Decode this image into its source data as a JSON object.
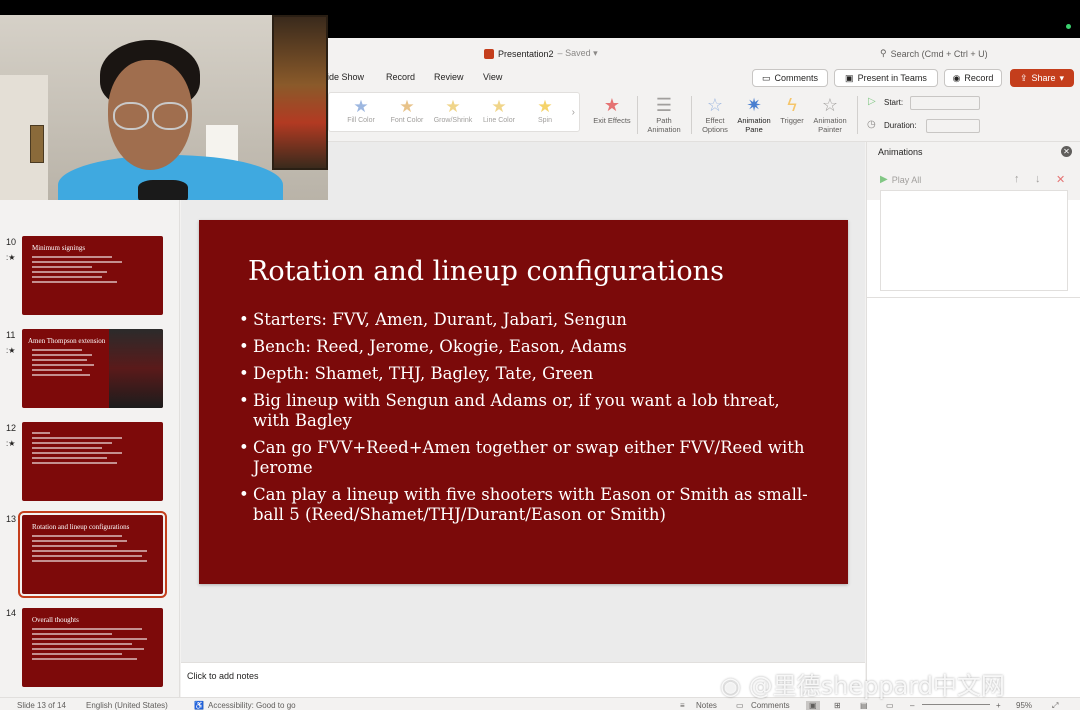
{
  "window": {
    "doc_title": "Presentation2",
    "saved_status": "Saved",
    "search_placeholder": "Search (Cmd + Ctrl + U)"
  },
  "menu": {
    "items": [
      "ide Show",
      "Record",
      "Review",
      "View"
    ],
    "comments_label": "Comments",
    "present_teams_label": "Present in Teams",
    "record_label": "Record",
    "share_label": "Share"
  },
  "ribbon": {
    "effects": [
      "Fill Color",
      "Font Color",
      "Grow/Shrink",
      "Line Color",
      "Spin"
    ],
    "exit_effects": "Exit Effects",
    "path_animation": "Path Animation",
    "effect_options": "Effect Options",
    "animation_pane": "Animation Pane",
    "trigger": "Trigger",
    "animation_painter": "Animation Painter",
    "start_label": "Start:",
    "duration_label": "Duration:"
  },
  "slides_panel": {
    "thumbs": [
      {
        "num": "10",
        "title": "Minimum signings"
      },
      {
        "num": "11",
        "title": "Amen Thompson extension"
      },
      {
        "num": "12",
        "title": ""
      },
      {
        "num": "13",
        "title": "Rotation and lineup configurations"
      },
      {
        "num": "14",
        "title": "Overall thoughts"
      }
    ]
  },
  "slide": {
    "title": "Rotation and lineup configurations",
    "bullets": [
      "Starters: FVV, Amen, Durant, Jabari, Sengun",
      "Bench: Reed, Jerome, Okogie, Eason, Adams",
      "Depth: Shamet, THJ, Bagley, Tate, Green",
      "Big lineup with Sengun and Adams or, if you want a lob threat, with Bagley",
      "Can go FVV+Reed+Amen together or swap either FVV/Reed with Jerome",
      "Can play a lineup with five shooters with Eason or Smith as small-ball 5 (Reed/Shamet/THJ/Durant/Eason or Smith)"
    ]
  },
  "notes": {
    "placeholder": "Click to add notes"
  },
  "animations_pane": {
    "title": "Animations",
    "play_all": "Play All"
  },
  "status": {
    "slide_counter": "Slide 13 of 14",
    "language": "English (United States)",
    "accessibility": "Accessibility: Good to go",
    "notes": "Notes",
    "comments": "Comments",
    "zoom": "95%"
  },
  "watermark": {
    "text": "@里德sheppard中文网"
  },
  "colors": {
    "slide_bg": "#7b0a0a",
    "accent": "#c43e1c"
  }
}
